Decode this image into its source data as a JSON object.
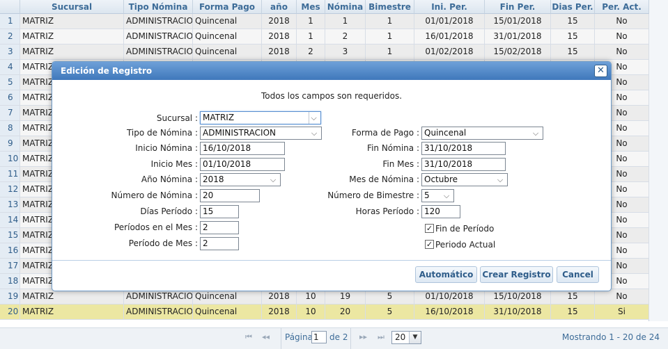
{
  "grid": {
    "columns": [
      "",
      "Sucursal",
      "Tipo Nómina",
      "Forma Pago",
      "año",
      "Mes",
      "Nómina",
      "Bimestre",
      "Ini. Per.",
      "Fin Per.",
      "Dias Per.",
      "Per. Act."
    ],
    "rows": [
      {
        "n": "1",
        "sucursal": "MATRIZ",
        "tipo": "ADMINISTRACION",
        "forma": "Quincenal",
        "anio": "2018",
        "mes": "1",
        "nomina": "1",
        "bimestre": "1",
        "ini": "01/01/2018",
        "fin": "15/01/2018",
        "dias": "15",
        "act": "No"
      },
      {
        "n": "2",
        "sucursal": "MATRIZ",
        "tipo": "ADMINISTRACION",
        "forma": "Quincenal",
        "anio": "2018",
        "mes": "1",
        "nomina": "2",
        "bimestre": "1",
        "ini": "16/01/2018",
        "fin": "31/01/2018",
        "dias": "15",
        "act": "No"
      },
      {
        "n": "3",
        "sucursal": "MATRIZ",
        "tipo": "ADMINISTRACION",
        "forma": "Quincenal",
        "anio": "2018",
        "mes": "2",
        "nomina": "3",
        "bimestre": "1",
        "ini": "01/02/2018",
        "fin": "15/02/2018",
        "dias": "15",
        "act": "No"
      },
      {
        "n": "4",
        "sucursal": "MATRIZ",
        "tipo": "",
        "forma": "",
        "anio": "",
        "mes": "",
        "nomina": "",
        "bimestre": "",
        "ini": "",
        "fin": "",
        "dias": "",
        "act": "No"
      },
      {
        "n": "5",
        "sucursal": "MATRIZ",
        "tipo": "",
        "forma": "",
        "anio": "",
        "mes": "",
        "nomina": "",
        "bimestre": "",
        "ini": "",
        "fin": "",
        "dias": "",
        "act": "No"
      },
      {
        "n": "6",
        "sucursal": "MATRIZ",
        "tipo": "",
        "forma": "",
        "anio": "",
        "mes": "",
        "nomina": "",
        "bimestre": "",
        "ini": "",
        "fin": "",
        "dias": "",
        "act": "No"
      },
      {
        "n": "7",
        "sucursal": "MATRIZ",
        "tipo": "",
        "forma": "",
        "anio": "",
        "mes": "",
        "nomina": "",
        "bimestre": "",
        "ini": "",
        "fin": "",
        "dias": "",
        "act": "No"
      },
      {
        "n": "8",
        "sucursal": "MATRIZ",
        "tipo": "",
        "forma": "",
        "anio": "",
        "mes": "",
        "nomina": "",
        "bimestre": "",
        "ini": "",
        "fin": "",
        "dias": "",
        "act": "No"
      },
      {
        "n": "9",
        "sucursal": "MATRIZ",
        "tipo": "",
        "forma": "",
        "anio": "",
        "mes": "",
        "nomina": "",
        "bimestre": "",
        "ini": "",
        "fin": "",
        "dias": "",
        "act": "No"
      },
      {
        "n": "10",
        "sucursal": "MATRIZ",
        "tipo": "",
        "forma": "",
        "anio": "",
        "mes": "",
        "nomina": "",
        "bimestre": "",
        "ini": "",
        "fin": "",
        "dias": "",
        "act": "No"
      },
      {
        "n": "11",
        "sucursal": "MATRIZ",
        "tipo": "",
        "forma": "",
        "anio": "",
        "mes": "",
        "nomina": "",
        "bimestre": "",
        "ini": "",
        "fin": "",
        "dias": "",
        "act": "No"
      },
      {
        "n": "12",
        "sucursal": "MATRIZ",
        "tipo": "",
        "forma": "",
        "anio": "",
        "mes": "",
        "nomina": "",
        "bimestre": "",
        "ini": "",
        "fin": "",
        "dias": "",
        "act": "No"
      },
      {
        "n": "13",
        "sucursal": "MATRIZ",
        "tipo": "",
        "forma": "",
        "anio": "",
        "mes": "",
        "nomina": "",
        "bimestre": "",
        "ini": "",
        "fin": "",
        "dias": "",
        "act": "No"
      },
      {
        "n": "14",
        "sucursal": "MATRIZ",
        "tipo": "",
        "forma": "",
        "anio": "",
        "mes": "",
        "nomina": "",
        "bimestre": "",
        "ini": "",
        "fin": "",
        "dias": "",
        "act": "No"
      },
      {
        "n": "15",
        "sucursal": "MATRIZ",
        "tipo": "",
        "forma": "",
        "anio": "",
        "mes": "",
        "nomina": "",
        "bimestre": "",
        "ini": "",
        "fin": "",
        "dias": "",
        "act": "No"
      },
      {
        "n": "16",
        "sucursal": "MATRIZ",
        "tipo": "",
        "forma": "",
        "anio": "",
        "mes": "",
        "nomina": "",
        "bimestre": "",
        "ini": "",
        "fin": "",
        "dias": "",
        "act": "No"
      },
      {
        "n": "17",
        "sucursal": "MATRIZ",
        "tipo": "",
        "forma": "",
        "anio": "",
        "mes": "",
        "nomina": "",
        "bimestre": "",
        "ini": "",
        "fin": "",
        "dias": "",
        "act": "No"
      },
      {
        "n": "18",
        "sucursal": "MATRIZ",
        "tipo": "",
        "forma": "",
        "anio": "",
        "mes": "",
        "nomina": "",
        "bimestre": "",
        "ini": "",
        "fin": "",
        "dias": "",
        "act": "No"
      },
      {
        "n": "19",
        "sucursal": "MATRIZ",
        "tipo": "ADMINISTRACION",
        "forma": "Quincenal",
        "anio": "2018",
        "mes": "10",
        "nomina": "19",
        "bimestre": "5",
        "ini": "01/10/2018",
        "fin": "15/10/2018",
        "dias": "15",
        "act": "No"
      },
      {
        "n": "20",
        "sucursal": "MATRIZ",
        "tipo": "ADMINISTRACION",
        "forma": "Quincenal",
        "anio": "2018",
        "mes": "10",
        "nomina": "20",
        "bimestre": "5",
        "ini": "16/10/2018",
        "fin": "31/10/2018",
        "dias": "15",
        "act": "Si"
      }
    ]
  },
  "pager": {
    "page_label": "Página",
    "page_value": "1",
    "of_label": "de 2",
    "page_size": "20",
    "summary": "Mostrando 1 - 20 de 24"
  },
  "modal": {
    "title": "Edición de Registro",
    "note": "Todos los campos son requeridos.",
    "fields": {
      "sucursal": {
        "label": "Sucursal :",
        "value": "MATRIZ"
      },
      "tipo_nomina": {
        "label": "Tipo de Nómina :",
        "value": "ADMINISTRACION"
      },
      "forma_pago": {
        "label": "Forma de Pago :",
        "value": "Quincenal"
      },
      "inicio_nomina": {
        "label": "Inicio Nómina :",
        "value": "16/10/2018"
      },
      "fin_nomina": {
        "label": "Fin Nómina :",
        "value": "31/10/2018"
      },
      "inicio_mes": {
        "label": "Inicio Mes :",
        "value": "01/10/2018"
      },
      "fin_mes": {
        "label": "Fin Mes :",
        "value": "31/10/2018"
      },
      "anio_nomina": {
        "label": "Año Nómina :",
        "value": "2018"
      },
      "mes_nomina": {
        "label": "Mes de Nómina :",
        "value": "Octubre"
      },
      "numero_nomina": {
        "label": "Número de Nómina :",
        "value": "20"
      },
      "numero_bimestre": {
        "label": "Número de Bimestre :",
        "value": "5"
      },
      "dias_periodo": {
        "label": "Días Período :",
        "value": "15"
      },
      "horas_periodo": {
        "label": "Horas Período :",
        "value": "120"
      },
      "periodos_mes": {
        "label": "Períodos en el Mes :",
        "value": "2"
      },
      "periodo_de_mes": {
        "label": "Período de Mes :",
        "value": "2"
      },
      "fin_periodo": {
        "label": "Fin de Período",
        "checked": true
      },
      "periodo_actual": {
        "label": "Periodo Actual",
        "checked": true
      }
    },
    "buttons": {
      "auto": "Automático",
      "create": "Crear Registro",
      "cancel": "Cancel"
    }
  },
  "colors": {
    "header_text": "#3d6c98",
    "selected_row": "#ece7a2",
    "modal_title_bg": "#3f78bb"
  }
}
